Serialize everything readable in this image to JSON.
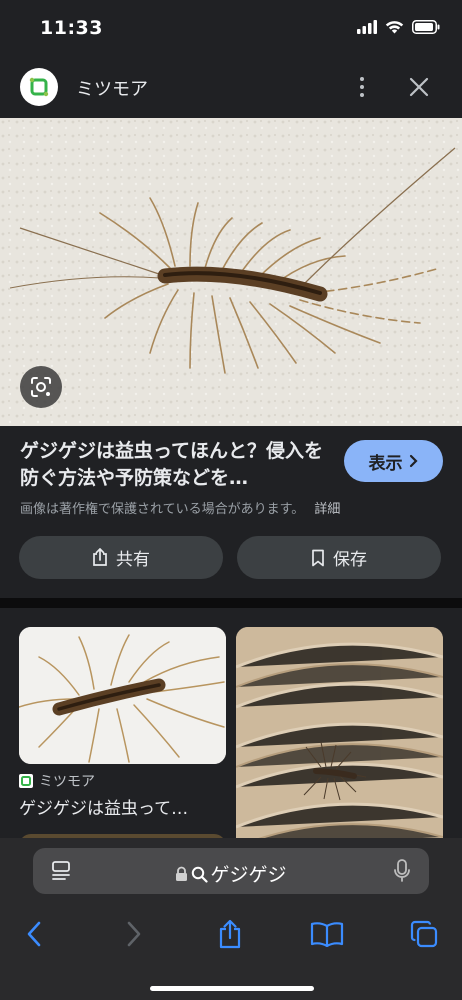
{
  "status_bar": {
    "time": "11:33"
  },
  "header": {
    "site_name": "ミツモア",
    "icons": [
      "mitsumoa-logo-icon",
      "more-vert-icon",
      "close-icon"
    ]
  },
  "hero": {
    "lens_icon": "google-lens-icon"
  },
  "result": {
    "title": "ゲジゲジは益虫ってほんと？侵入を防ぐ方法や予防策などを…",
    "visit_label": "表示",
    "copyright_note": "画像は著作権で保護されている場合があります。",
    "details_link": "詳細",
    "share_label": "共有",
    "save_label": "保存"
  },
  "related": [
    {
      "source": "ミツモア",
      "title": "ゲジゲジは益虫って…"
    }
  ],
  "address_bar": {
    "query": "ゲジゲジ"
  },
  "toolbar": {
    "icons": [
      "back-icon",
      "forward-icon",
      "share-icon",
      "bookmarks-icon",
      "tabs-icon"
    ]
  },
  "colors": {
    "accent": "#8ab4f8",
    "background": "#202124",
    "button_bg": "#3c4043"
  }
}
